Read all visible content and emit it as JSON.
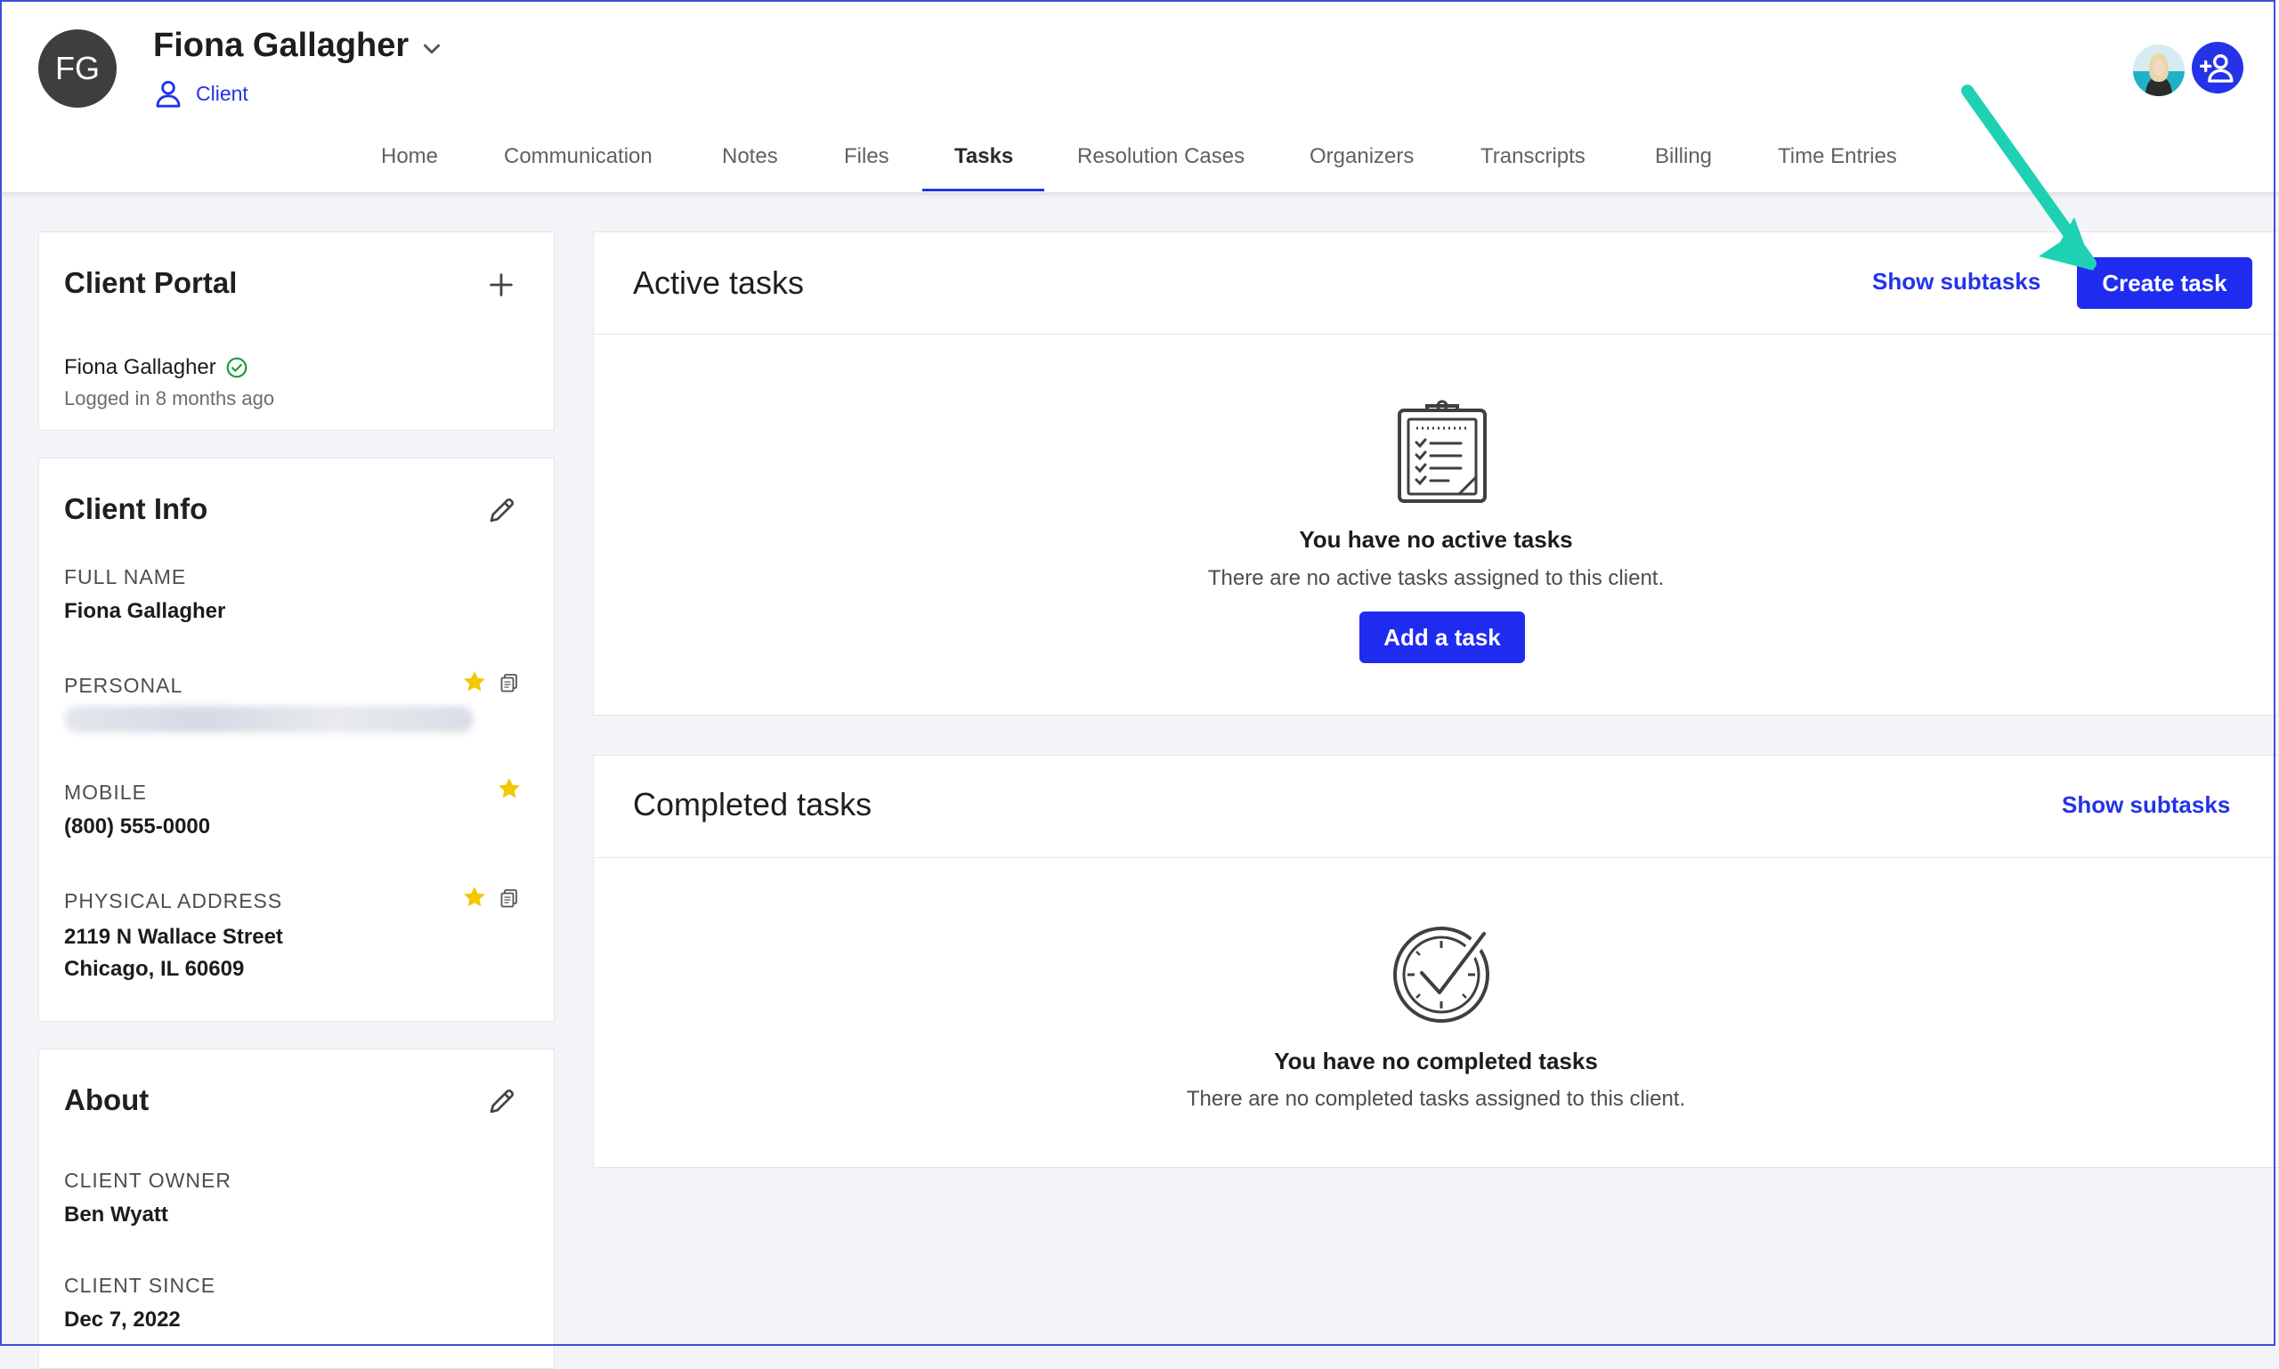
{
  "header": {
    "avatar_initials": "FG",
    "client_name": "Fiona Gallagher",
    "client_role": "Client"
  },
  "nav": {
    "tabs": [
      "Home",
      "Communication",
      "Notes",
      "Files",
      "Tasks",
      "Resolution Cases",
      "Organizers",
      "Transcripts",
      "Billing",
      "Time Entries"
    ],
    "active": "Tasks"
  },
  "client_portal": {
    "title": "Client Portal",
    "user": "Fiona Gallagher",
    "last_login": "Logged in 8 months ago"
  },
  "client_info": {
    "title": "Client Info",
    "full_name_label": "FULL NAME",
    "full_name": "Fiona Gallagher",
    "personal_label": "PERSONAL",
    "mobile_label": "MOBILE",
    "mobile": "(800) 555-0000",
    "address_label": "PHYSICAL ADDRESS",
    "address_line1": "2119 N Wallace Street",
    "address_line2": "Chicago, IL 60609"
  },
  "about": {
    "title": "About",
    "owner_label": "CLIENT OWNER",
    "owner": "Ben Wyatt",
    "since_label": "CLIENT SINCE",
    "since": "Dec 7, 2022"
  },
  "active_tasks": {
    "title": "Active tasks",
    "show_subtasks": "Show subtasks",
    "create_task": "Create task",
    "empty_title": "You have no active tasks",
    "empty_sub": "There are no active tasks assigned to this client.",
    "add_task": "Add a task"
  },
  "completed_tasks": {
    "title": "Completed tasks",
    "show_subtasks": "Show subtasks",
    "empty_title": "You have no completed tasks",
    "empty_sub": "There are no completed tasks assigned to this client."
  },
  "colors": {
    "accent": "#2433e8",
    "button": "#1f2cf0",
    "annotation_arrow": "#1fd1b3",
    "star": "#f2c800",
    "verified": "#1a9a3f"
  },
  "icons": {
    "role": "person-outline-icon",
    "caret": "chevron-down-icon",
    "add_user": "add-user-icon",
    "portal_add": "plus-icon",
    "edit": "pencil-icon",
    "star": "star-icon",
    "copy": "copy-icon",
    "verified": "check-circle-icon",
    "active_empty": "clipboard-checklist-icon",
    "completed_empty": "check-badge-icon"
  }
}
